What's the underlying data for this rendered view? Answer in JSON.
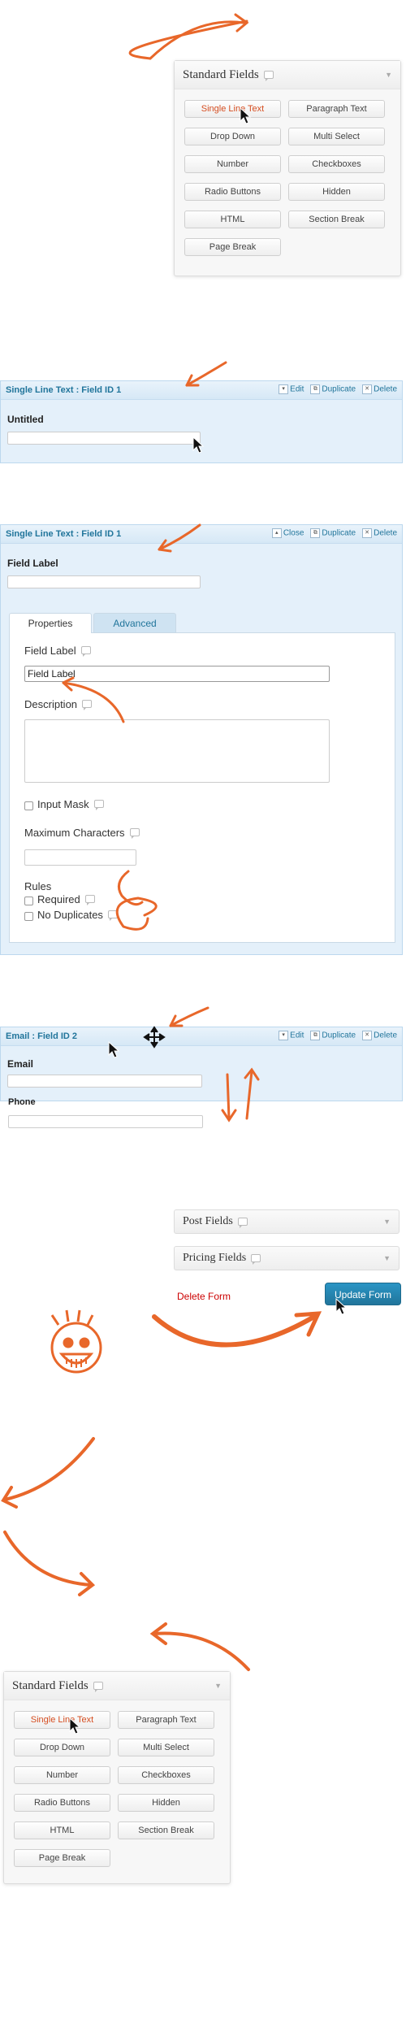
{
  "standard_fields": {
    "title": "Standard Fields",
    "buttons": [
      "Single Line Text",
      "Paragraph Text",
      "Drop Down",
      "Multi Select",
      "Number",
      "Checkboxes",
      "Radio Buttons",
      "Hidden",
      "HTML",
      "Section Break",
      "Page Break"
    ]
  },
  "field1": {
    "bar_title": "Single Line Text : Field ID 1",
    "edit": "Edit",
    "duplicate": "Duplicate",
    "delete": "Delete",
    "label": "Untitled"
  },
  "field1_open": {
    "bar_title": "Single Line Text : Field ID 1",
    "close": "Close",
    "duplicate": "Duplicate",
    "delete": "Delete",
    "label": "Field Label",
    "tabs": [
      "Properties",
      "Advanced"
    ],
    "field_label_heading": "Field Label",
    "field_label_value": "Field Label",
    "description_heading": "Description",
    "input_mask": "Input Mask",
    "max_chars": "Maximum Characters",
    "rules_heading": "Rules",
    "required": "Required",
    "no_duplicates": "No Duplicates"
  },
  "field2": {
    "bar_title": "Email : Field ID 2",
    "edit": "Edit",
    "duplicate": "Duplicate",
    "delete": "Delete",
    "label": "Email",
    "phone_label": "Phone"
  },
  "sidebar": {
    "post_fields": "Post Fields",
    "pricing_fields": "Pricing Fields",
    "delete_form": "Delete Form",
    "update_form": "Update Form"
  },
  "colors": {
    "accent": "#21759b",
    "arrow": "#e8672a",
    "active": "#d54e21"
  }
}
